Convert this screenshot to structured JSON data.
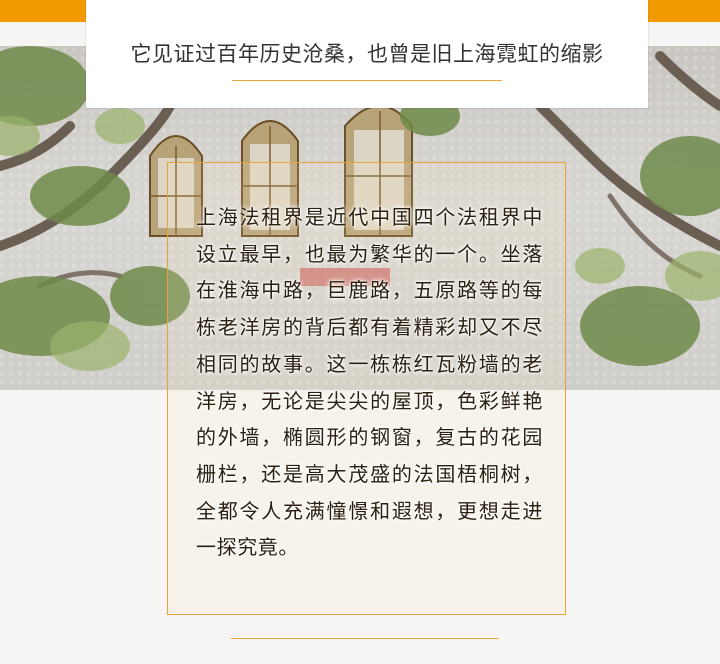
{
  "header": {
    "title": "它见证过百年历史沧桑，也曾是旧上海霓虹的缩影"
  },
  "article": {
    "body": "上海法租界是近代中国四个法租界中设立最早，也最为繁华的一个。坐落在淮海中路，巨鹿路，五原路等的每栋老洋房的背后都有着精彩却又不尽相同的故事。这一栋栋红瓦粉墙的老洋房，无论是尖尖的屋顶，色彩鲜艳的外墙，椭圆形的钢窗，复古的花园栅栏，还是高大茂盛的法国梧桐树，全都令人充满憧憬和遐想，更想走进一探究竟。"
  },
  "colors": {
    "accent_orange": "#f39a00",
    "rule_gold": "#e8a43a"
  }
}
